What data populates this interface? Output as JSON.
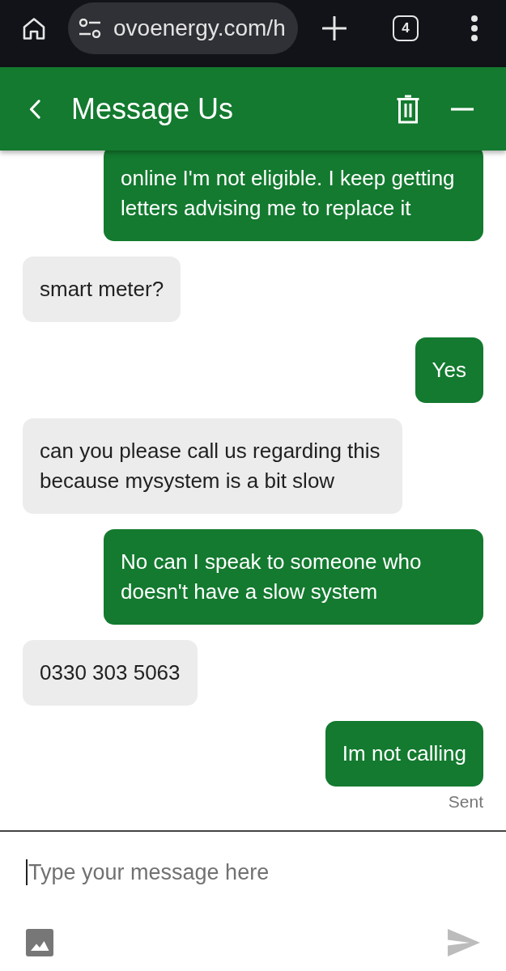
{
  "browser": {
    "url": "ovoenergy.com/h",
    "tab_count": "4"
  },
  "header": {
    "title": "Message Us"
  },
  "messages": [
    {
      "kind": "user",
      "text": "online I'm not eligible. I keep getting letters advising me to replace it"
    },
    {
      "kind": "agent",
      "text": "smart meter?"
    },
    {
      "kind": "user",
      "text": "Yes"
    },
    {
      "kind": "agent",
      "text": "can you please call us regarding this because mysystem is a bit slow"
    },
    {
      "kind": "user",
      "text": "No can I speak to someone who doesn't have a slow system"
    },
    {
      "kind": "agent",
      "text": "0330 303 5063"
    },
    {
      "kind": "user",
      "text": "Im not calling",
      "status": "Sent"
    }
  ],
  "composer": {
    "placeholder": "Type your message here",
    "focused": true
  }
}
